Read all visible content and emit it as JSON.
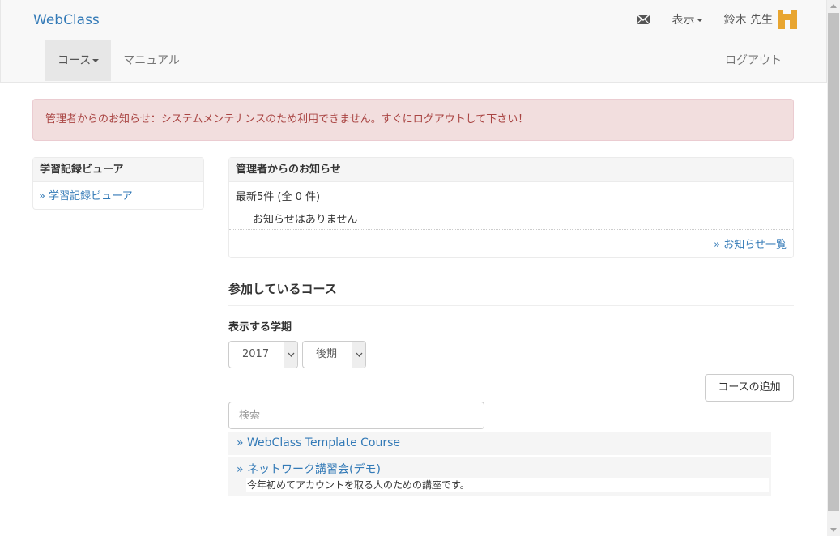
{
  "navbar": {
    "brand": "WebClass",
    "display_label": "表示",
    "user_name": "鈴木 先生",
    "items": [
      {
        "label": "コース"
      },
      {
        "label": "マニュアル"
      }
    ],
    "logout_label": "ログアウト"
  },
  "alert": {
    "text": "管理者からのお知らせ：システムメンテナンスのため利用できません。すぐにログアウトして下さい！"
  },
  "sidebar": {
    "heading": "学習記録ビューア",
    "link": "» 学習記録ビューア"
  },
  "news": {
    "heading": "管理者からのお知らせ",
    "summary": "最新5件 (全 0 件)",
    "empty": "お知らせはありません",
    "list_link": "» お知らせ一覧"
  },
  "courses": {
    "title": "参加しているコース",
    "term_label": "表示する学期",
    "year_value": "2017",
    "term_value": "後期",
    "add_label": "コースの追加",
    "search_placeholder": "検索",
    "list": [
      {
        "title": "» WebClass Template Course"
      },
      {
        "title": "» ネットワーク講習会(デモ)",
        "description": "今年初めてアカウントを取る人のための講座です。"
      }
    ]
  },
  "colors": {
    "brand": "#337ab7",
    "alert_bg": "#f2dede",
    "alert_text": "#a94442",
    "avatar": "#e8a530"
  }
}
